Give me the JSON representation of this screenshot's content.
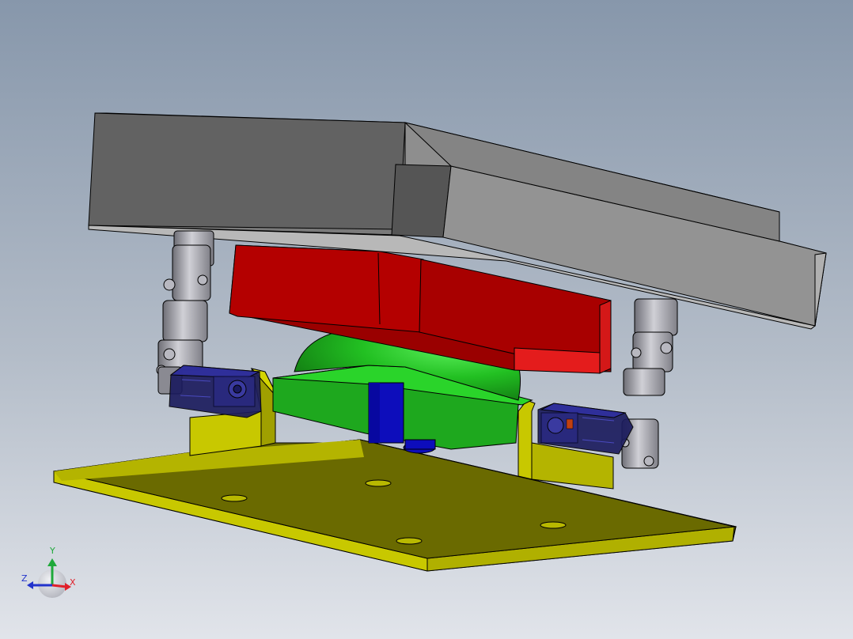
{
  "view": {
    "background_top": "#8797ab",
    "background_bottom": "#e1e4ea"
  },
  "triad": {
    "x_label": "X",
    "y_label": "Y",
    "z_label": "Z",
    "x_color": "#e0202a",
    "y_color": "#1fa93a",
    "z_color": "#2233cc"
  },
  "parts": [
    {
      "name": "top-plate",
      "color": "#a0a0a0"
    },
    {
      "name": "red-block",
      "color": "#c00000"
    },
    {
      "name": "green-dome",
      "color": "#22c022"
    },
    {
      "name": "blue-shaft",
      "color": "#0a0aa0"
    },
    {
      "name": "base-plate",
      "color": "#c8c800"
    },
    {
      "name": "servo-left",
      "color": "#22227a"
    },
    {
      "name": "servo-right",
      "color": "#22227a"
    },
    {
      "name": "universal-joint-left",
      "color": "#9a9aa2"
    },
    {
      "name": "universal-joint-right",
      "color": "#9a9aa2"
    }
  ]
}
